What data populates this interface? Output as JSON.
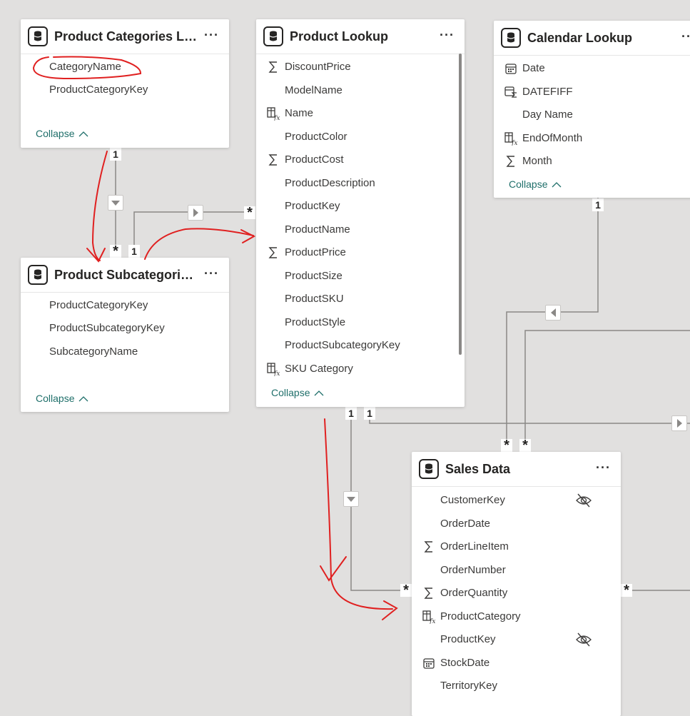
{
  "tables": {
    "categories": {
      "title": "Product Categories Loo...",
      "fields": [
        "CategoryName",
        "ProductCategoryKey"
      ],
      "collapse": "Collapse"
    },
    "subcategories": {
      "title": "Product Subcategories ...",
      "fields": [
        "ProductCategoryKey",
        "ProductSubcategoryKey",
        "SubcategoryName"
      ],
      "collapse": "Collapse"
    },
    "product": {
      "title": "Product Lookup",
      "fields": [
        {
          "name": "DiscountPrice",
          "icon": "sigma-icon"
        },
        {
          "name": "ModelName",
          "icon": ""
        },
        {
          "name": "Name",
          "icon": "calculated-column-icon"
        },
        {
          "name": "ProductColor",
          "icon": ""
        },
        {
          "name": "ProductCost",
          "icon": "sigma-icon"
        },
        {
          "name": "ProductDescription",
          "icon": ""
        },
        {
          "name": "ProductKey",
          "icon": ""
        },
        {
          "name": "ProductName",
          "icon": ""
        },
        {
          "name": "ProductPrice",
          "icon": "sigma-icon"
        },
        {
          "name": "ProductSize",
          "icon": ""
        },
        {
          "name": "ProductSKU",
          "icon": ""
        },
        {
          "name": "ProductStyle",
          "icon": ""
        },
        {
          "name": "ProductSubcategoryKey",
          "icon": ""
        },
        {
          "name": "SKU Category",
          "icon": "calculated-column-icon"
        }
      ],
      "collapse": "Collapse"
    },
    "calendar": {
      "title": "Calendar Lookup",
      "fields": [
        {
          "name": "Date",
          "icon": "calendar-icon"
        },
        {
          "name": "DATEFIFF",
          "icon": "calculated-date-icon"
        },
        {
          "name": "Day Name",
          "icon": ""
        },
        {
          "name": "EndOfMonth",
          "icon": "calculated-column-icon"
        },
        {
          "name": "Month",
          "icon": "sigma-icon"
        }
      ],
      "collapse": "Collapse"
    },
    "sales": {
      "title": "Sales Data",
      "fields": [
        {
          "name": "CustomerKey",
          "icon": "",
          "hidden": true
        },
        {
          "name": "OrderDate",
          "icon": ""
        },
        {
          "name": "OrderLineItem",
          "icon": "sigma-icon"
        },
        {
          "name": "OrderNumber",
          "icon": ""
        },
        {
          "name": "OrderQuantity",
          "icon": "sigma-icon"
        },
        {
          "name": "ProductCategory",
          "icon": "calculated-column-icon"
        },
        {
          "name": "ProductKey",
          "icon": "",
          "hidden": true
        },
        {
          "name": "StockDate",
          "icon": "calendar-icon"
        },
        {
          "name": "TerritoryKey",
          "icon": ""
        }
      ]
    }
  },
  "cardinality": {
    "one": "1",
    "many": "*"
  },
  "more_label": "···",
  "colors": {
    "canvas": "#e1e0df",
    "line": "#8a8886",
    "accent": "#1f6f6a",
    "annotation": "#e02020"
  }
}
